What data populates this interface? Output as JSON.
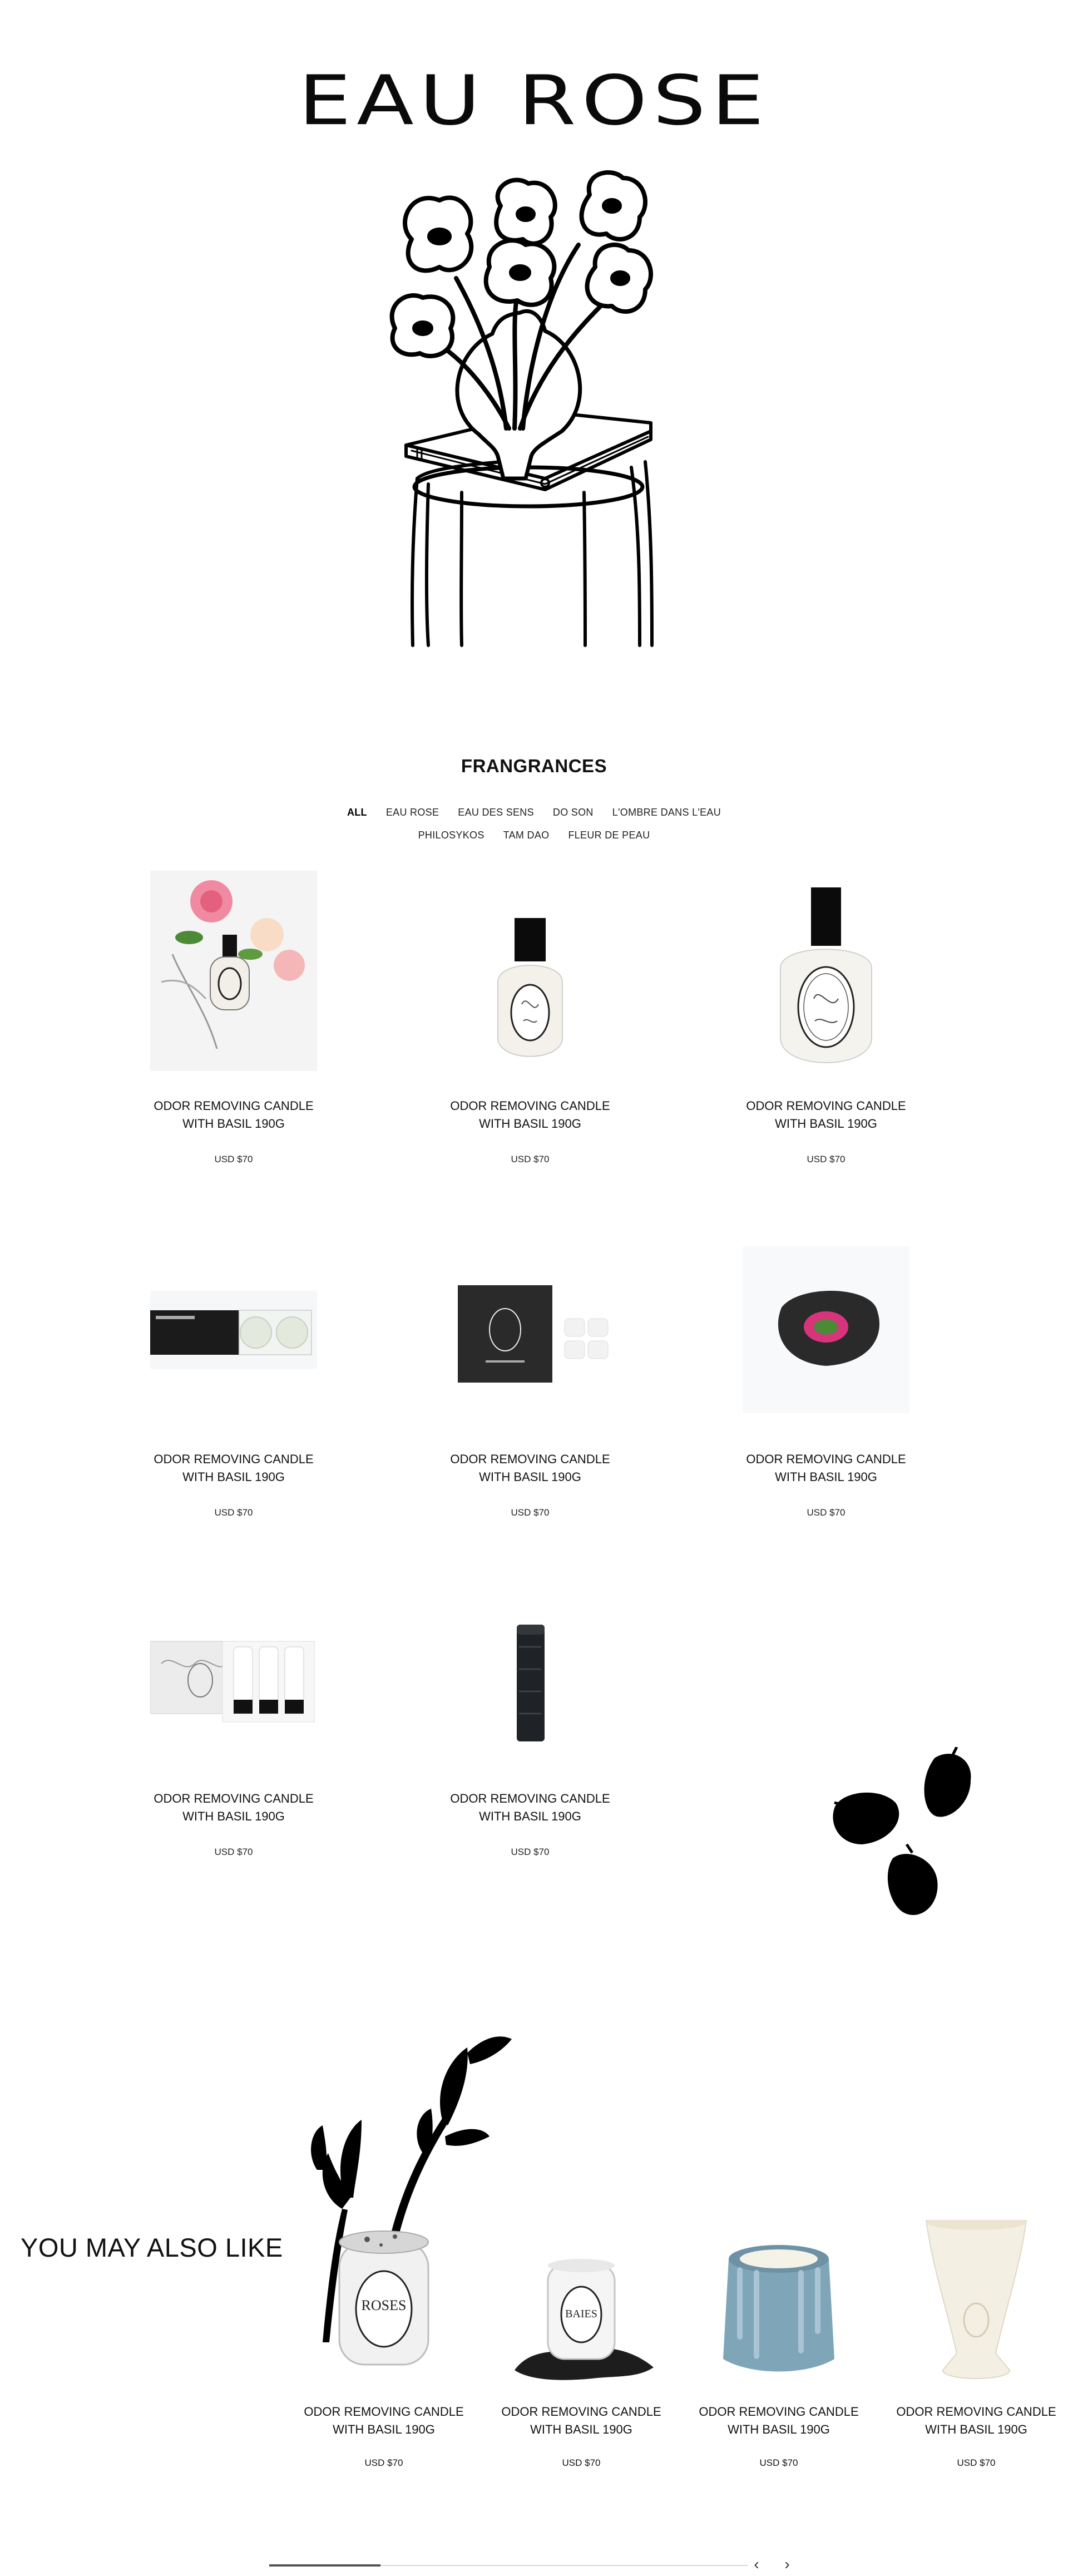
{
  "hero": {
    "title": "EAU ROSE"
  },
  "section": {
    "title": "FRANGRANCES"
  },
  "filters": {
    "row1": [
      "ALL",
      "EAU ROSE",
      "EAU DES SENS",
      "DO SON",
      "L'OMBRE DANS L'EAU"
    ],
    "row2": [
      "PHILOSYKOS",
      "TAM DAO",
      "FLEUR DE PEAU"
    ],
    "active": "ALL"
  },
  "products": [
    {
      "name_line1": "ODOR REMOVING CANDLE",
      "name_line2": "WITH BASIL 190G",
      "price": "USD $70",
      "image": "rose-bouquet-bottle"
    },
    {
      "name_line1": "ODOR REMOVING CANDLE",
      "name_line2": "WITH BASIL 190G",
      "price": "USD $70",
      "image": "small-perfume-bottle"
    },
    {
      "name_line1": "ODOR REMOVING CANDLE",
      "name_line2": "WITH BASIL 190G",
      "price": "USD $70",
      "image": "large-perfume-bottle"
    },
    {
      "name_line1": "ODOR REMOVING CANDLE",
      "name_line2": "WITH BASIL 190G",
      "price": "USD $70",
      "image": "solid-perfume-case"
    },
    {
      "name_line1": "ODOR REMOVING CANDLE",
      "name_line2": "WITH BASIL 190G",
      "price": "USD $70",
      "image": "black-box-with-refills"
    },
    {
      "name_line1": "ODOR REMOVING CANDLE",
      "name_line2": "WITH BASIL 190G",
      "price": "USD $70",
      "image": "black-oval-compact"
    },
    {
      "name_line1": "ODOR REMOVING CANDLE",
      "name_line2": "WITH BASIL 190G",
      "price": "USD $70",
      "image": "gift-set-tubes"
    },
    {
      "name_line1": "ODOR REMOVING CANDLE",
      "name_line2": "WITH BASIL 190G",
      "price": "USD $70",
      "image": "black-stick"
    }
  ],
  "also_like": {
    "title": "YOU MAY ALSO LIKE",
    "items": [
      {
        "name_line1": "ODOR REMOVING CANDLE",
        "name_line2": "WITH BASIL 190G",
        "price": "USD $70",
        "image": "roses-candle",
        "label": "ROSES"
      },
      {
        "name_line1": "ODOR REMOVING CANDLE",
        "name_line2": "WITH BASIL 190G",
        "price": "USD $70",
        "image": "baies-candle-black-stand",
        "label": "BAIES"
      },
      {
        "name_line1": "ODOR REMOVING CANDLE",
        "name_line2": "WITH BASIL 190G",
        "price": "USD $70",
        "image": "blue-drip-candle"
      },
      {
        "name_line1": "ODOR REMOVING CANDLE",
        "name_line2": "WITH BASIL 190G",
        "price": "USD $70",
        "image": "white-vase-candle"
      }
    ]
  },
  "slider": {
    "prev_icon": "chevron-left-icon",
    "next_icon": "chevron-right-icon",
    "prev": "‹",
    "next": "›"
  }
}
